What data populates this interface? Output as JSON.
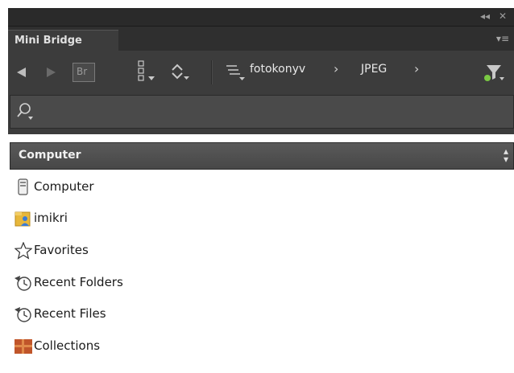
{
  "window": {
    "collapse_glyph": "◂◂",
    "close_glyph": "✕"
  },
  "tab": {
    "title": "Mini Bridge",
    "panel_menu_glyph": "▾≡"
  },
  "toolbar": {
    "back_icon": "back-arrow-icon",
    "forward_icon": "forward-arrow-icon",
    "bridge_label": "Br",
    "path": [
      "fotokonyv",
      "JPEG"
    ],
    "path_separator": "›"
  },
  "search": {
    "placeholder": ""
  },
  "location": {
    "selected": "Computer"
  },
  "nav_items": [
    {
      "label": "Computer",
      "icon": "computer-icon"
    },
    {
      "label": "imikri",
      "icon": "user-folder-icon"
    },
    {
      "label": "Favorites",
      "icon": "star-icon"
    },
    {
      "label": "Recent Folders",
      "icon": "recent-folders-icon"
    },
    {
      "label": "Recent Files",
      "icon": "recent-files-icon"
    },
    {
      "label": "Collections",
      "icon": "collections-icon"
    }
  ],
  "colors": {
    "panel_dark": "#3c3c3c",
    "tab_bg": "#2f2f2f",
    "text_light": "#e0e0e0",
    "filter_green": "#7ac943"
  }
}
